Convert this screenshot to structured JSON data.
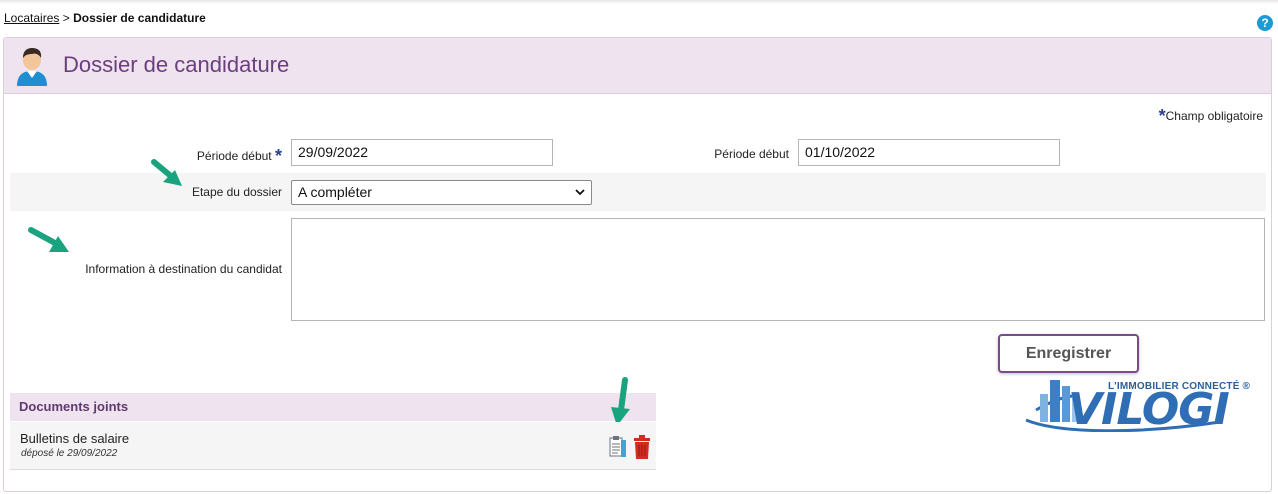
{
  "breadcrumb": {
    "parent": "Locataires",
    "separator": ">",
    "current": "Dossier de candidature"
  },
  "help_symbol": "?",
  "panel": {
    "title": "Dossier de candidature"
  },
  "mandatory_note": {
    "star": "*",
    "text": "Champ obligatoire"
  },
  "form": {
    "periode_debut_1": {
      "label": "Période début",
      "star": "*",
      "value": "29/09/2022"
    },
    "periode_debut_2": {
      "label": "Période début",
      "value": "01/10/2022"
    },
    "etape": {
      "label": "Etape du dossier",
      "value": "A compléter"
    },
    "information": {
      "label": "Information à destination du candidat",
      "value": ""
    }
  },
  "save_label": "Enregistrer",
  "documents": {
    "header": "Documents joints",
    "items": [
      {
        "name": "Bulletins de salaire",
        "date": "déposé le 29/09/2022"
      }
    ]
  },
  "logo": {
    "tagline": "L'IMMOBILIER CONNECTÉ ®",
    "name": "VILOGI"
  },
  "colors": {
    "accent": "#6c3e7d",
    "header_bg": "#efe3f0",
    "arrow": "#1aa37f",
    "logo_blue": "#2f6db5",
    "help_blue": "#1c9ad6"
  },
  "icons": {
    "avatar": "user-avatar-icon",
    "view": "document-view-icon",
    "delete": "trash-icon",
    "help": "help-icon",
    "chevron": "chevron-down-icon"
  }
}
